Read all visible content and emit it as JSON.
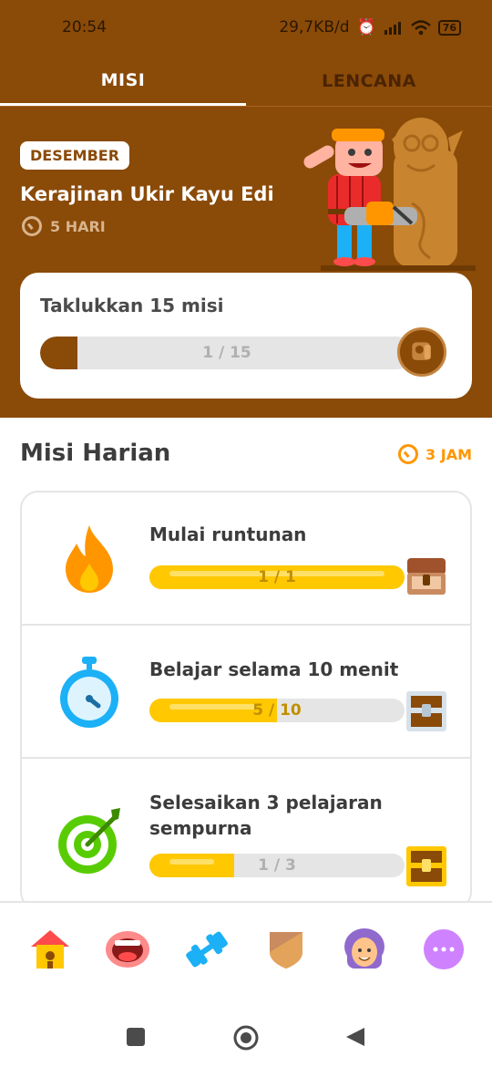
{
  "status_bar": {
    "time": "20:54",
    "net_speed": "29,7KB/d",
    "battery": "76"
  },
  "tabs": [
    {
      "label": "MISI",
      "active": true
    },
    {
      "label": "LENCANA",
      "active": false
    }
  ],
  "monthly_event": {
    "month": "DESEMBER",
    "title": "Kerajinan Ukir Kayu Edi",
    "time_left": "5 HARI",
    "challenge": {
      "title": "Taklukkan 15 misi",
      "progress_text": "1 / 15",
      "current": 1,
      "total": 15
    }
  },
  "daily_quests": {
    "header": "Misi Harian",
    "time_left": "3 JAM",
    "items": [
      {
        "title": "Mulai runtunan",
        "progress_text": "1 / 1",
        "current": 1,
        "total": 1,
        "icon": "flame-icon",
        "chest_state": "opened"
      },
      {
        "title": "Belajar selama 10 menit",
        "progress_text": "5 / 10",
        "current": 5,
        "total": 10,
        "icon": "stopwatch-icon",
        "chest_state": "silver"
      },
      {
        "title": "Selesaikan 3 pelajaran sempurna",
        "progress_text": "1 / 3",
        "current": 1,
        "total": 3,
        "icon": "target-icon",
        "chest_state": "gold"
      }
    ]
  },
  "bottom_nav": [
    "home-icon",
    "speak-icon",
    "practice-icon",
    "leagues-icon",
    "profile-icon",
    "more-icon"
  ],
  "colors": {
    "brown": "#8a4a08",
    "gold": "#ffc800",
    "orange": "#ff9600",
    "gray": "#e5e5e5"
  }
}
